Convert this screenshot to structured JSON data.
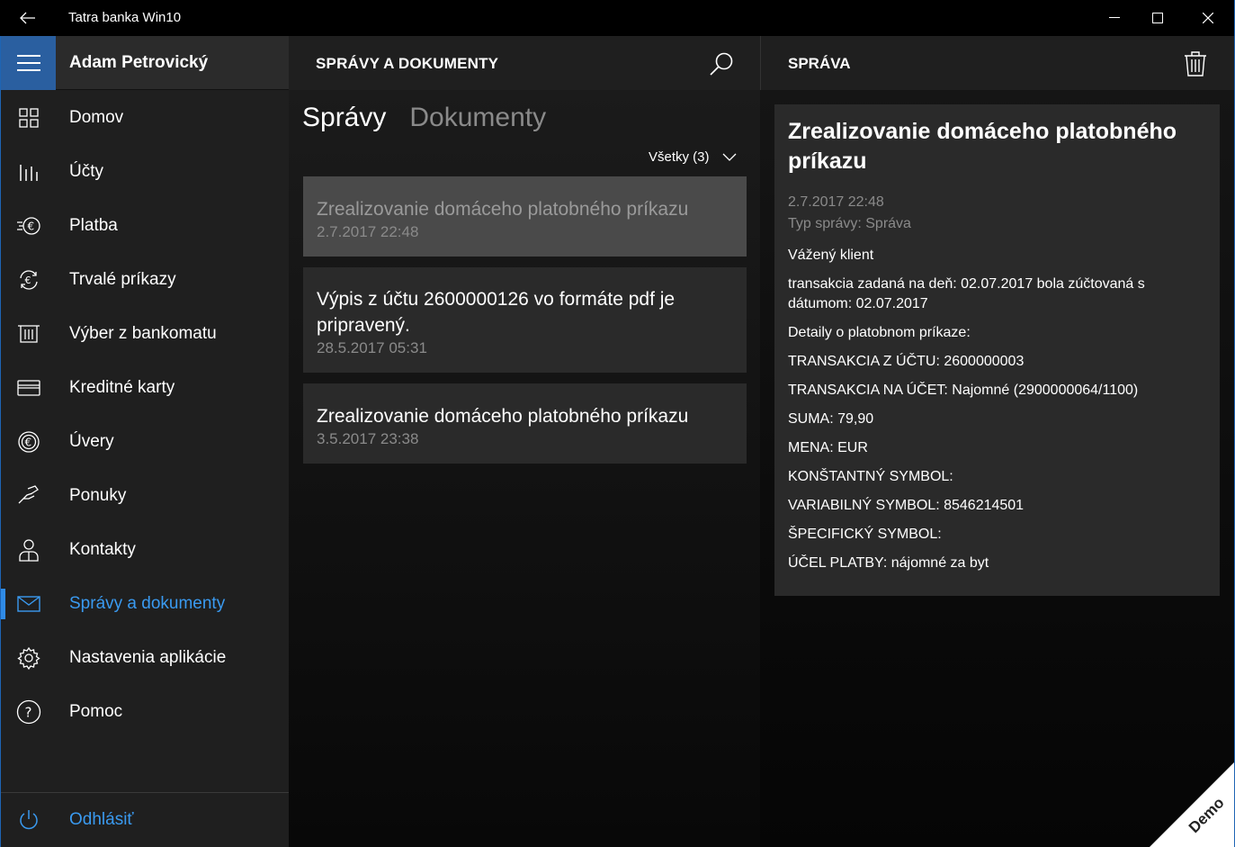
{
  "window": {
    "title": "Tatra banka Win10"
  },
  "sidebar": {
    "user": "Adam Petrovický",
    "items": [
      {
        "label": "Domov",
        "icon": "home-grid-icon"
      },
      {
        "label": "Účty",
        "icon": "accounts-bars-icon"
      },
      {
        "label": "Platba",
        "icon": "payment-euro-icon"
      },
      {
        "label": "Trvalé príkazy",
        "icon": "standing-order-icon"
      },
      {
        "label": "Výber z bankomatu",
        "icon": "atm-icon"
      },
      {
        "label": "Kreditné karty",
        "icon": "credit-card-icon"
      },
      {
        "label": "Úvery",
        "icon": "loan-euro-icon"
      },
      {
        "label": "Ponuky",
        "icon": "offers-hand-icon"
      },
      {
        "label": "Kontakty",
        "icon": "contacts-person-icon"
      },
      {
        "label": "Správy a dokumenty",
        "icon": "mail-icon",
        "active": true
      },
      {
        "label": "Nastavenia aplikácie",
        "icon": "gear-icon"
      },
      {
        "label": "Pomoc",
        "icon": "help-icon"
      }
    ],
    "logout": "Odhlásiť"
  },
  "middle": {
    "header": "SPRÁVY A DOKUMENTY",
    "tabs": {
      "active": "Správy",
      "inactive": "Dokumenty"
    },
    "filter": "Všetky (3)",
    "messages": [
      {
        "title": "Zrealizovanie domáceho platobného príkazu",
        "date": "2.7.2017 22:48",
        "selected": true
      },
      {
        "title": "Výpis z účtu 2600000126 vo formáte pdf je pripravený.",
        "date": "28.5.2017 05:31"
      },
      {
        "title": "Zrealizovanie domáceho platobného príkazu",
        "date": "3.5.2017 23:38"
      }
    ]
  },
  "detail": {
    "header": "SPRÁVA",
    "title": "Zrealizovanie domáceho platobného príkazu",
    "date": "2.7.2017 22:48",
    "type": "Typ správy: Správa",
    "lines": [
      "Vážený klient",
      "transakcia zadaná na deň: 02.07.2017 bola zúčtovaná s dátumom: 02.07.2017",
      "Detaily o platobnom príkaze:",
      "TRANSAKCIA Z ÚČTU: 2600000003",
      "TRANSAKCIA NA ÚČET: Najomné (2900000064/1100)",
      "SUMA: 79,90",
      "MENA: EUR",
      "KONŠTANTNÝ SYMBOL:",
      "VARIABILNÝ SYMBOL: 8546214501",
      "ŠPECIFICKÝ SYMBOL:",
      "ÚČEL PLATBY: nájomné za byt"
    ]
  },
  "ribbon": {
    "text": "Demo"
  },
  "colors": {
    "accent": "#3a9af0",
    "hamburger_bg": "#2a5fa0"
  }
}
